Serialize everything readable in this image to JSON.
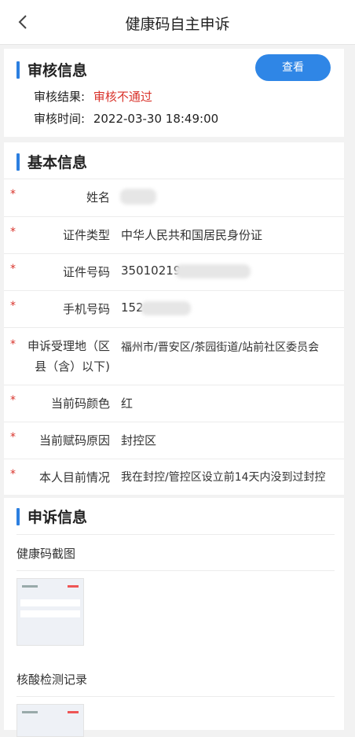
{
  "header": {
    "title": "健康码自主申诉"
  },
  "audit": {
    "section_title": "审核信息",
    "view_button": "查看",
    "result_label": "审核结果:",
    "result_value": "审核不通过",
    "time_label": "审核时间:",
    "time_value": "2022-03-30 18:49:00"
  },
  "basic": {
    "section_title": "基本信息",
    "required_mark": "*",
    "rows": [
      {
        "label": "姓名",
        "value": ""
      },
      {
        "label": "证件类型",
        "value": "中华人民共和国居民身份证"
      },
      {
        "label": "证件号码",
        "value": "35010219"
      },
      {
        "label": "手机号码",
        "value": "152"
      },
      {
        "label": "申诉受理地（区县（含）以下)",
        "value": "福州市/晋安区/茶园街道/站前社区委员会"
      },
      {
        "label": "当前码颜色",
        "value": "红"
      },
      {
        "label": "当前赋码原因",
        "value": "封控区"
      },
      {
        "label": "本人目前情况",
        "value": "我在封控/管控区设立前14天内没到过封控"
      }
    ]
  },
  "appeal": {
    "section_title": "申诉信息",
    "screenshot_label": "健康码截图",
    "nucleic_label": "核酸检测记录"
  },
  "colors": {
    "accent": "#2c7fe0",
    "button": "#2f86e6",
    "required": "#d9332b"
  }
}
